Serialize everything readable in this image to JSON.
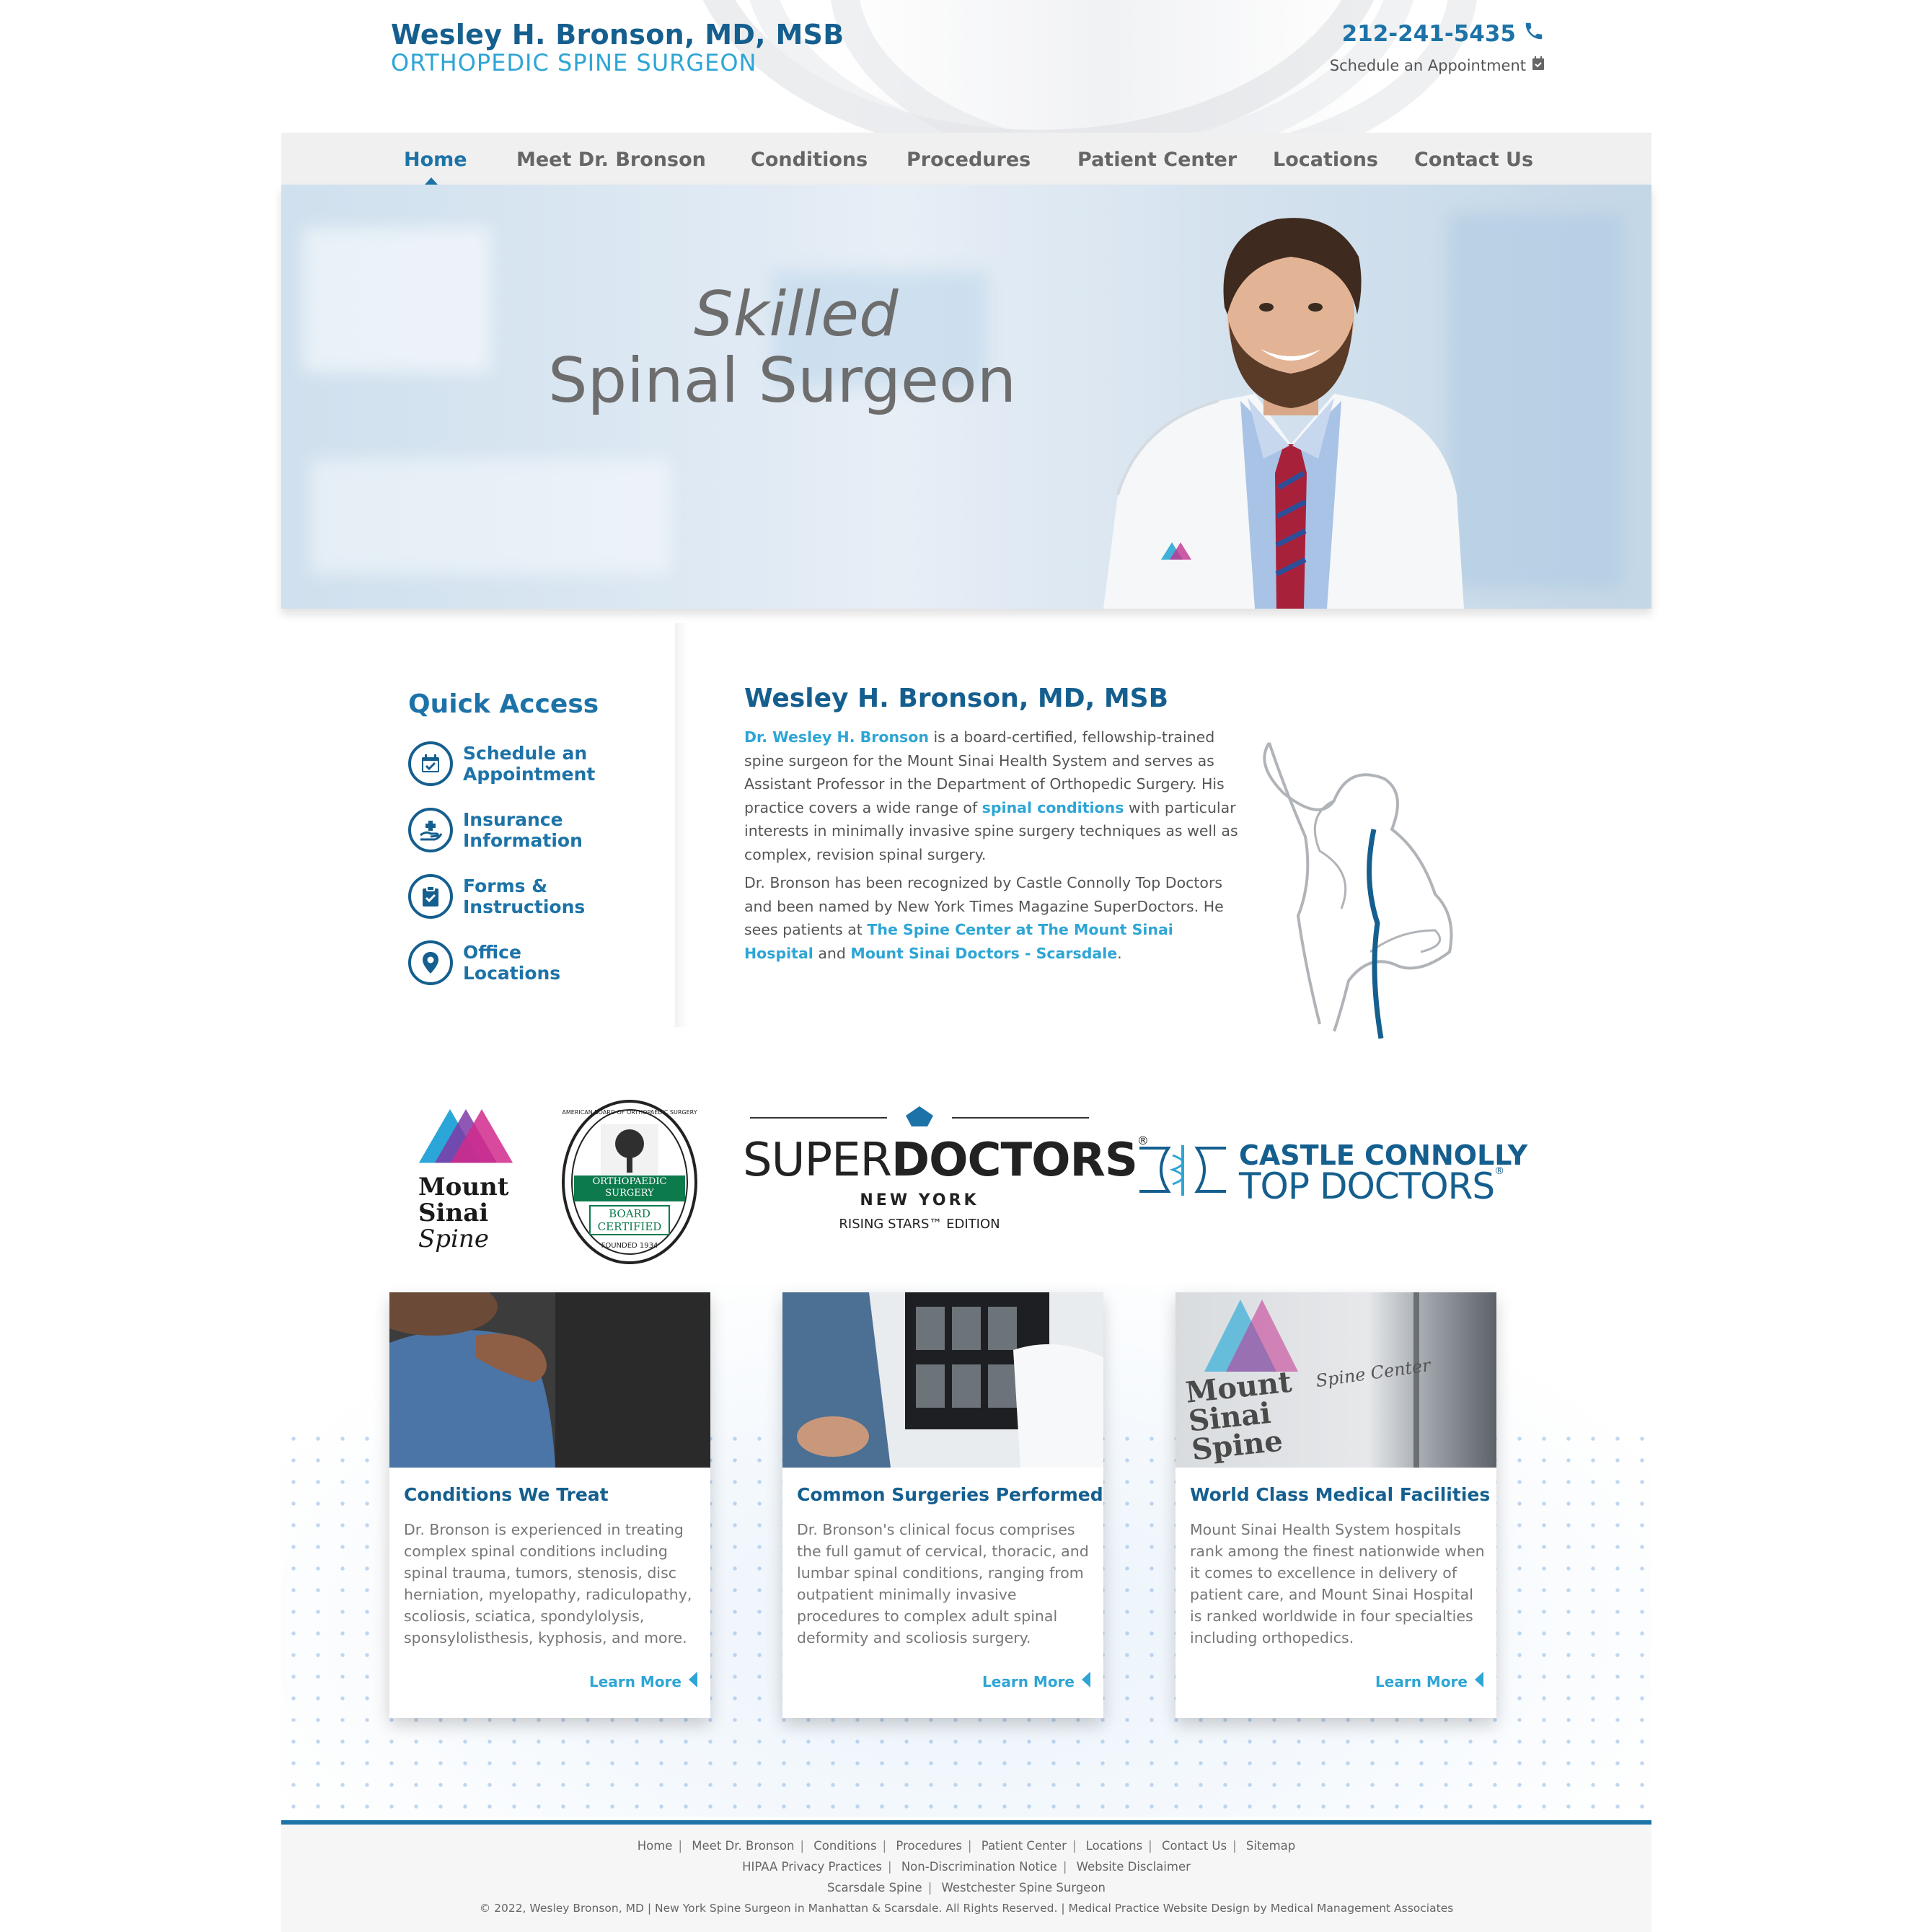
{
  "header": {
    "name": "Wesley H. Bronson, MD, MSB",
    "subtitle": "ORTHOPEDIC SPINE SURGEON",
    "phone": "212-241-5435",
    "schedule": "Schedule an Appointment"
  },
  "nav": {
    "items": [
      "Home",
      "Meet Dr. Bronson",
      "Conditions",
      "Procedures",
      "Patient Center",
      "Locations",
      "Contact Us"
    ]
  },
  "hero": {
    "line1": "Skilled",
    "line2": "Spinal Surgeon"
  },
  "quick_access": {
    "title": "Quick Access",
    "items": [
      {
        "line1": "Schedule an",
        "line2": "Appointment",
        "icon": "calendar-check-icon"
      },
      {
        "line1": "Insurance",
        "line2": "Information",
        "icon": "hand-plus-icon"
      },
      {
        "line1": "Forms &",
        "line2": "Instructions",
        "icon": "clipboard-check-icon"
      },
      {
        "line1": "Office",
        "line2": "Locations",
        "icon": "map-pin-icon"
      }
    ]
  },
  "intro": {
    "title": "Wesley H. Bronson, MD, MSB",
    "p1_link1": "Dr. Wesley H. Bronson",
    "p1_text1": " is a board-certified, fellowship-trained spine surgeon for the Mount Sinai Health System and serves as Assistant Professor in the Department of Orthopedic Surgery. His practice covers a wide range of ",
    "p1_link2": "spinal conditions",
    "p1_text2": " with particular interests in minimally invasive spine surgery techniques as well as complex, revision spinal surgery.",
    "p2_text1": "Dr. Bronson has been recognized by Castle Connolly Top Doctors and been named by New York Times Magazine SuperDoctors. He sees patients at ",
    "p2_link1": "The Spine Center at The Mount Sinai Hospital",
    "p2_text2": " and ",
    "p2_link2": "Mount Sinai Doctors - Scarsdale",
    "p2_text3": "."
  },
  "logos": {
    "mount_sinai": {
      "line1": "Mount",
      "line2": "Sinai",
      "line3": "Spine"
    },
    "abos": {
      "ring": "AMERICAN BOARD OF ORTHOPAEDIC SURGERY",
      "band1": "ORTHOPAEDIC",
      "band2": "SURGERY",
      "line1": "BOARD",
      "line2": "CERTIFIED",
      "founded": "FOUNDED 1934"
    },
    "superdoctors": {
      "super": "SUPER",
      "doctors": "DOCTORS",
      "reg": "®",
      "region": "NEW YORK",
      "edition": "RISING STARS™ EDITION"
    },
    "castle": {
      "line1": "CASTLE CONNOLLY",
      "line2": "TOP DOCTORS",
      "reg": "®"
    }
  },
  "cards": [
    {
      "title": "Conditions We Treat",
      "text": "Dr. Bronson is experienced in treating complex spinal conditions including spinal trauma, tumors, stenosis, disc herniation, myelopathy, radiculopathy, scoliosis, sciatica, spondylolysis, sponsylolisthesis, kyphosis, and more.",
      "more": "Learn More"
    },
    {
      "title": "Common Surgeries Performed",
      "text": "Dr. Bronson's clinical focus comprises the full gamut of cervical, thoracic, and lumbar spinal conditions, ranging from outpatient minimally invasive procedures to complex adult spinal deformity and scoliosis surgery.",
      "more": "Learn More"
    },
    {
      "title": "World Class Medical Facilities",
      "text": "Mount Sinai Health System hospitals rank among the finest nationwide when it comes to excellence in delivery of patient care, and Mount Sinai Hospital is ranked worldwide in four specialties including orthopedics.",
      "more": "Learn More",
      "img_text1": "Mount",
      "img_text2": "Sinai",
      "img_text3": "Spine",
      "img_text4": "Spine Center"
    }
  ],
  "footer": {
    "row1": [
      "Home",
      "Meet Dr. Bronson",
      "Conditions",
      "Procedures",
      "Patient Center",
      "Locations",
      "Contact Us",
      "Sitemap"
    ],
    "row2": [
      "HIPAA Privacy Practices",
      "Non-Discrimination Notice",
      "Website Disclaimer"
    ],
    "row3": [
      "Scarsdale Spine",
      "Westchester Spine Surgeon"
    ],
    "copyright": "© 2022, Wesley Bronson, MD | New York Spine Surgeon in Manhattan & Scarsdale. All Rights Reserved. | Medical Practice Website Design by Medical Management Associates"
  },
  "colors": {
    "primary": "#155f8f",
    "accent": "#2ea5d5",
    "nav_active": "#1d73a8"
  }
}
